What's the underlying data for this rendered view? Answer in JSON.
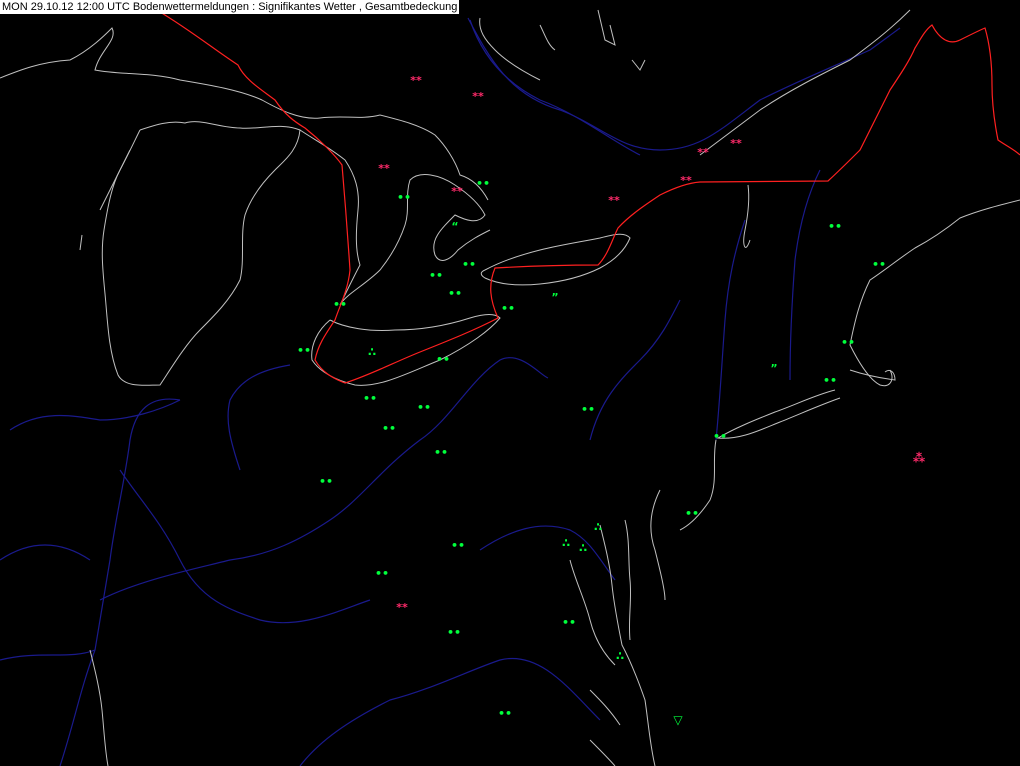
{
  "header": {
    "title": "MON 29.10.12 12:00 UTC  Bodenwettermeldungen :  Signifikantes Wetter , Gesamtbedeckung"
  },
  "colors": {
    "background": "#000000",
    "coast": "#c0c0c0",
    "river": "#1a1a8c",
    "border": "#ff2020",
    "rain": "#00ff3c",
    "snow": "#ff2a6a"
  },
  "symbols": {
    "rain": "••",
    "drizzle": "“",
    "drizzle_alt": "”",
    "snow": "**",
    "showers": "∴",
    "shower_triangle": "▽",
    "snow_triangle": "⁂"
  },
  "observations": [
    {
      "sym": "snow"
    },
    {
      "sym": "snow"
    },
    {
      "sym": "snow"
    },
    {
      "sym": "snow"
    },
    {
      "sym": "snow"
    },
    {
      "sym": "snow"
    },
    {
      "sym": "snow"
    },
    {
      "sym": "snow"
    },
    {
      "sym": "snow"
    },
    {
      "sym": "snow_triangle"
    },
    {
      "sym": "rain"
    },
    {
      "sym": "rain"
    },
    {
      "sym": "drizzle"
    },
    {
      "sym": "rain"
    },
    {
      "sym": "rain"
    },
    {
      "sym": "rain"
    },
    {
      "sym": "rain"
    },
    {
      "sym": "rain"
    },
    {
      "sym": "drizzle_alt"
    },
    {
      "sym": "rain"
    },
    {
      "sym": "rain"
    },
    {
      "sym": "showers"
    },
    {
      "sym": "rain"
    },
    {
      "sym": "rain"
    },
    {
      "sym": "rain"
    },
    {
      "sym": "rain"
    },
    {
      "sym": "rain"
    },
    {
      "sym": "rain"
    },
    {
      "sym": "rain"
    },
    {
      "sym": "rain"
    },
    {
      "sym": "drizzle_alt"
    },
    {
      "sym": "rain"
    },
    {
      "sym": "rain"
    },
    {
      "sym": "rain"
    },
    {
      "sym": "showers"
    },
    {
      "sym": "rain"
    },
    {
      "sym": "showers"
    },
    {
      "sym": "rain"
    },
    {
      "sym": "showers"
    },
    {
      "sym": "rain"
    },
    {
      "sym": "rain"
    },
    {
      "sym": "rain"
    },
    {
      "sym": "showers"
    },
    {
      "sym": "rain"
    },
    {
      "sym": "shower_triangle"
    }
  ]
}
